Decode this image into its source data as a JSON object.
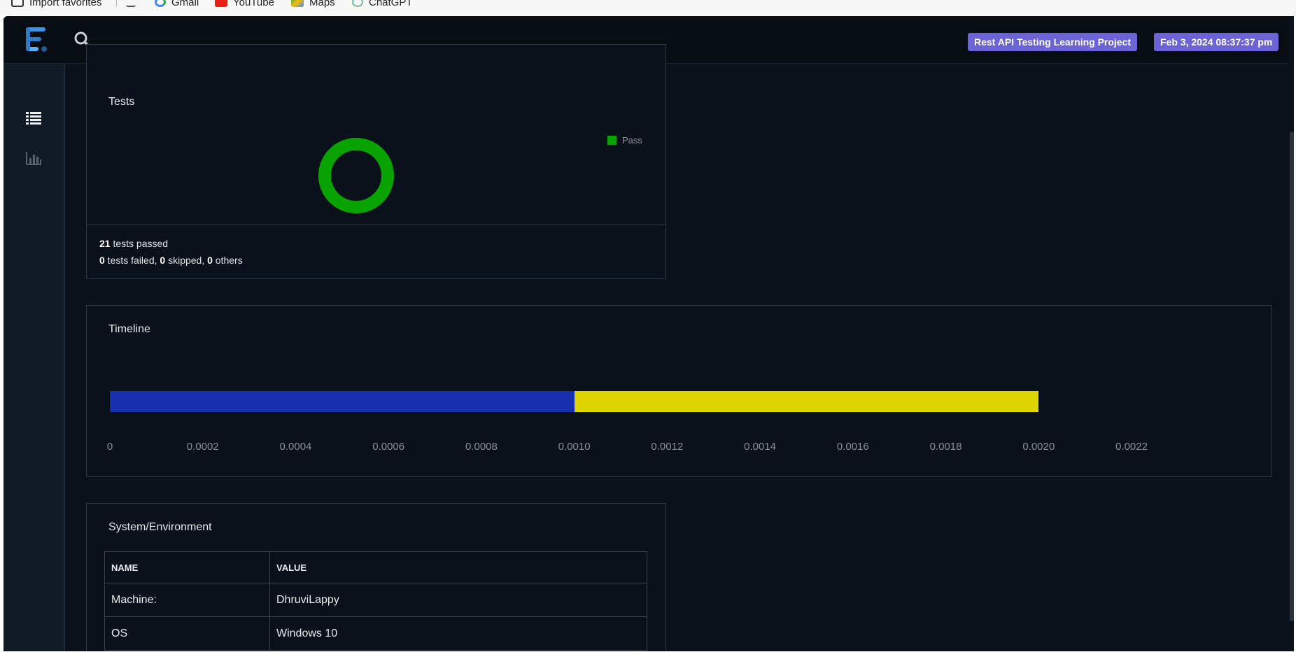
{
  "bookmarks": [
    {
      "label": "Import favorites",
      "icon": "import-icon"
    },
    {
      "label": "",
      "icon": "key-icon"
    },
    {
      "label": "Gmail",
      "icon": "google-icon"
    },
    {
      "label": "YouTube",
      "icon": "youtube-icon"
    },
    {
      "label": "Maps",
      "icon": "maps-icon"
    },
    {
      "label": "ChatGPT",
      "icon": "chatgpt-icon"
    }
  ],
  "header": {
    "project_badge": "Rest API Testing Learning Project",
    "date_badge": "Feb 3, 2024 08:37:37 pm"
  },
  "sidebar": {
    "items": [
      {
        "icon": "list-icon",
        "active": true
      },
      {
        "icon": "bar-chart-icon",
        "active": false
      }
    ]
  },
  "tests_card": {
    "title": "Tests",
    "legend": "Pass",
    "passed_count": "21",
    "passed_label": " tests passed",
    "failed_count": "0",
    "failed_label": " tests failed, ",
    "skipped_count": "0",
    "skipped_label": " skipped, ",
    "others_count": "0",
    "others_label": " others"
  },
  "timeline_card": {
    "title": "Timeline"
  },
  "chart_data": [
    {
      "type": "pie",
      "variant": "doughnut",
      "labels": [
        "Pass"
      ],
      "values": [
        21
      ],
      "colors": [
        "#09a300"
      ],
      "legend_position": "top-right"
    },
    {
      "type": "bar",
      "orientation": "horizontal",
      "stacked": true,
      "series": [
        {
          "values": [
            0.001
          ],
          "color": "#1730b0"
        },
        {
          "values": [
            0.001
          ],
          "color": "#ddd400"
        }
      ],
      "xlim": [
        0,
        0.0022
      ],
      "xticks": [
        "0",
        "0.0002",
        "0.0004",
        "0.0006",
        "0.0008",
        "0.0010",
        "0.0012",
        "0.0014",
        "0.0016",
        "0.0018",
        "0.0020",
        "0.0022"
      ],
      "grid": false
    }
  ],
  "env_card": {
    "title": "System/Environment",
    "columns": [
      "NAME",
      "VALUE"
    ],
    "rows": [
      [
        "Machine:",
        "DhruviLappy"
      ],
      [
        "OS",
        "Windows 10"
      ]
    ]
  }
}
